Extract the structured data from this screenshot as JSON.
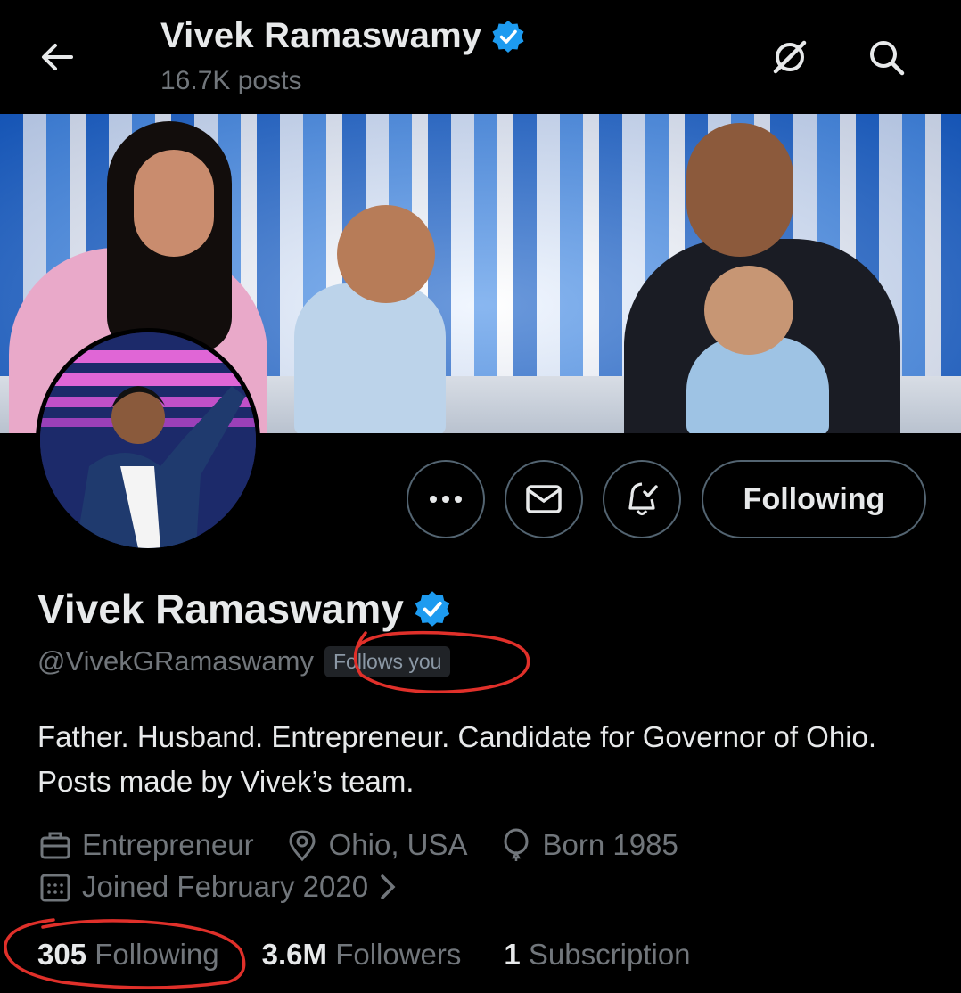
{
  "header": {
    "title": "Vivek Ramaswamy",
    "posts": "16.7K posts",
    "back_icon": "arrow-left-icon",
    "grok_icon": "grok-icon",
    "search_icon": "search-icon"
  },
  "actions": {
    "more_icon": "more-icon",
    "message_icon": "mail-icon",
    "notify_icon": "bell-icon",
    "follow_label": "Following"
  },
  "profile": {
    "name": "Vivek Ramaswamy",
    "handle": "@VivekGRamaswamy",
    "follows_you": "Follows you",
    "bio": "Father. Husband. Entrepreneur. Candidate for Governor of Ohio. Posts made by Vivek’s team.",
    "profession": "Entrepreneur",
    "location": "Ohio, USA",
    "born": "Born 1985",
    "joined": "Joined February 2020"
  },
  "stats": {
    "following_count": "305",
    "following_label": "Following",
    "followers_count": "3.6M",
    "followers_label": "Followers",
    "subscription_count": "1",
    "subscription_label": "Subscription"
  },
  "colors": {
    "background": "#000000",
    "text": "#e7e9ea",
    "secondary": "#71767b",
    "verified": "#1d9bf0",
    "annotation": "#e0302a"
  }
}
